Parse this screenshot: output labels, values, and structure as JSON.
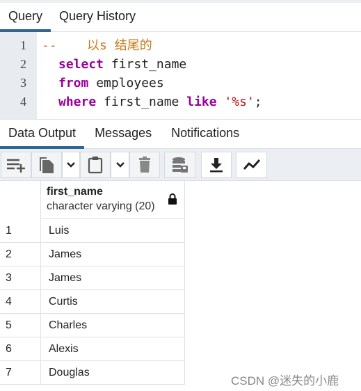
{
  "query_tabs": [
    {
      "label": "Query",
      "active": true
    },
    {
      "label": "Query History",
      "active": false
    }
  ],
  "editor": {
    "lines": [
      {
        "no": "1",
        "comment": "--    以s 结尾的"
      },
      {
        "no": "2",
        "kw1": "select",
        "rest": " first_name"
      },
      {
        "no": "3",
        "kw1": "from",
        "rest": " employees"
      },
      {
        "no": "4",
        "kw1": "where",
        "rest": " first_name ",
        "kw2": "like",
        "str": "'%s'",
        "end": ";"
      }
    ]
  },
  "result_tabs": [
    {
      "label": "Data Output",
      "active": true
    },
    {
      "label": "Messages",
      "active": false
    },
    {
      "label": "Notifications",
      "active": false
    }
  ],
  "toolbar": {
    "icons": [
      "add-row-icon",
      "copy-icon",
      "chevron-down-icon",
      "paste-icon",
      "chevron-down-icon",
      "delete-icon",
      "save-data-icon",
      "download-icon",
      "graph-icon"
    ]
  },
  "grid": {
    "column": {
      "name": "first_name",
      "type": "character varying (20)",
      "locked": true
    },
    "rows": [
      {
        "n": "1",
        "v": "Luis"
      },
      {
        "n": "2",
        "v": "James"
      },
      {
        "n": "3",
        "v": "James"
      },
      {
        "n": "4",
        "v": "Curtis"
      },
      {
        "n": "5",
        "v": "Charles"
      },
      {
        "n": "6",
        "v": "Alexis"
      },
      {
        "n": "7",
        "v": "Douglas"
      }
    ]
  },
  "watermark": "CSDN @迷失的小鹿",
  "colors": {
    "accent": "#326690",
    "keyword": "#990099",
    "comment": "#c77a1a",
    "string": "#b11a1a"
  }
}
